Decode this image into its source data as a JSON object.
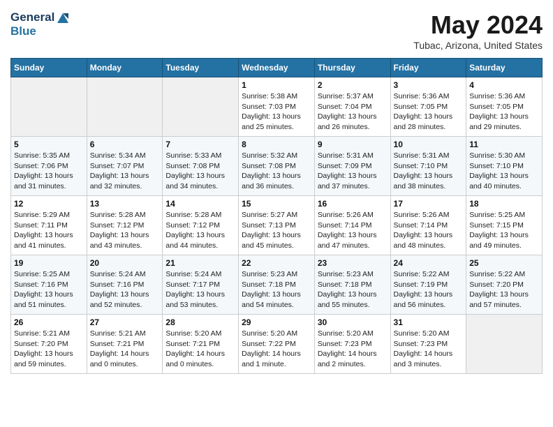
{
  "app": {
    "name_line1": "General",
    "name_line2": "Blue"
  },
  "calendar": {
    "title": "May 2024",
    "location": "Tubac, Arizona, United States",
    "days_of_week": [
      "Sunday",
      "Monday",
      "Tuesday",
      "Wednesday",
      "Thursday",
      "Friday",
      "Saturday"
    ],
    "weeks": [
      [
        {
          "day": "",
          "info": ""
        },
        {
          "day": "",
          "info": ""
        },
        {
          "day": "",
          "info": ""
        },
        {
          "day": "1",
          "info": "Sunrise: 5:38 AM\nSunset: 7:03 PM\nDaylight: 13 hours\nand 25 minutes."
        },
        {
          "day": "2",
          "info": "Sunrise: 5:37 AM\nSunset: 7:04 PM\nDaylight: 13 hours\nand 26 minutes."
        },
        {
          "day": "3",
          "info": "Sunrise: 5:36 AM\nSunset: 7:05 PM\nDaylight: 13 hours\nand 28 minutes."
        },
        {
          "day": "4",
          "info": "Sunrise: 5:36 AM\nSunset: 7:05 PM\nDaylight: 13 hours\nand 29 minutes."
        }
      ],
      [
        {
          "day": "5",
          "info": "Sunrise: 5:35 AM\nSunset: 7:06 PM\nDaylight: 13 hours\nand 31 minutes."
        },
        {
          "day": "6",
          "info": "Sunrise: 5:34 AM\nSunset: 7:07 PM\nDaylight: 13 hours\nand 32 minutes."
        },
        {
          "day": "7",
          "info": "Sunrise: 5:33 AM\nSunset: 7:08 PM\nDaylight: 13 hours\nand 34 minutes."
        },
        {
          "day": "8",
          "info": "Sunrise: 5:32 AM\nSunset: 7:08 PM\nDaylight: 13 hours\nand 36 minutes."
        },
        {
          "day": "9",
          "info": "Sunrise: 5:31 AM\nSunset: 7:09 PM\nDaylight: 13 hours\nand 37 minutes."
        },
        {
          "day": "10",
          "info": "Sunrise: 5:31 AM\nSunset: 7:10 PM\nDaylight: 13 hours\nand 38 minutes."
        },
        {
          "day": "11",
          "info": "Sunrise: 5:30 AM\nSunset: 7:10 PM\nDaylight: 13 hours\nand 40 minutes."
        }
      ],
      [
        {
          "day": "12",
          "info": "Sunrise: 5:29 AM\nSunset: 7:11 PM\nDaylight: 13 hours\nand 41 minutes."
        },
        {
          "day": "13",
          "info": "Sunrise: 5:28 AM\nSunset: 7:12 PM\nDaylight: 13 hours\nand 43 minutes."
        },
        {
          "day": "14",
          "info": "Sunrise: 5:28 AM\nSunset: 7:12 PM\nDaylight: 13 hours\nand 44 minutes."
        },
        {
          "day": "15",
          "info": "Sunrise: 5:27 AM\nSunset: 7:13 PM\nDaylight: 13 hours\nand 45 minutes."
        },
        {
          "day": "16",
          "info": "Sunrise: 5:26 AM\nSunset: 7:14 PM\nDaylight: 13 hours\nand 47 minutes."
        },
        {
          "day": "17",
          "info": "Sunrise: 5:26 AM\nSunset: 7:14 PM\nDaylight: 13 hours\nand 48 minutes."
        },
        {
          "day": "18",
          "info": "Sunrise: 5:25 AM\nSunset: 7:15 PM\nDaylight: 13 hours\nand 49 minutes."
        }
      ],
      [
        {
          "day": "19",
          "info": "Sunrise: 5:25 AM\nSunset: 7:16 PM\nDaylight: 13 hours\nand 51 minutes."
        },
        {
          "day": "20",
          "info": "Sunrise: 5:24 AM\nSunset: 7:16 PM\nDaylight: 13 hours\nand 52 minutes."
        },
        {
          "day": "21",
          "info": "Sunrise: 5:24 AM\nSunset: 7:17 PM\nDaylight: 13 hours\nand 53 minutes."
        },
        {
          "day": "22",
          "info": "Sunrise: 5:23 AM\nSunset: 7:18 PM\nDaylight: 13 hours\nand 54 minutes."
        },
        {
          "day": "23",
          "info": "Sunrise: 5:23 AM\nSunset: 7:18 PM\nDaylight: 13 hours\nand 55 minutes."
        },
        {
          "day": "24",
          "info": "Sunrise: 5:22 AM\nSunset: 7:19 PM\nDaylight: 13 hours\nand 56 minutes."
        },
        {
          "day": "25",
          "info": "Sunrise: 5:22 AM\nSunset: 7:20 PM\nDaylight: 13 hours\nand 57 minutes."
        }
      ],
      [
        {
          "day": "26",
          "info": "Sunrise: 5:21 AM\nSunset: 7:20 PM\nDaylight: 13 hours\nand 59 minutes."
        },
        {
          "day": "27",
          "info": "Sunrise: 5:21 AM\nSunset: 7:21 PM\nDaylight: 14 hours\nand 0 minutes."
        },
        {
          "day": "28",
          "info": "Sunrise: 5:20 AM\nSunset: 7:21 PM\nDaylight: 14 hours\nand 0 minutes."
        },
        {
          "day": "29",
          "info": "Sunrise: 5:20 AM\nSunset: 7:22 PM\nDaylight: 14 hours\nand 1 minute."
        },
        {
          "day": "30",
          "info": "Sunrise: 5:20 AM\nSunset: 7:23 PM\nDaylight: 14 hours\nand 2 minutes."
        },
        {
          "day": "31",
          "info": "Sunrise: 5:20 AM\nSunset: 7:23 PM\nDaylight: 14 hours\nand 3 minutes."
        },
        {
          "day": "",
          "info": ""
        }
      ]
    ]
  }
}
